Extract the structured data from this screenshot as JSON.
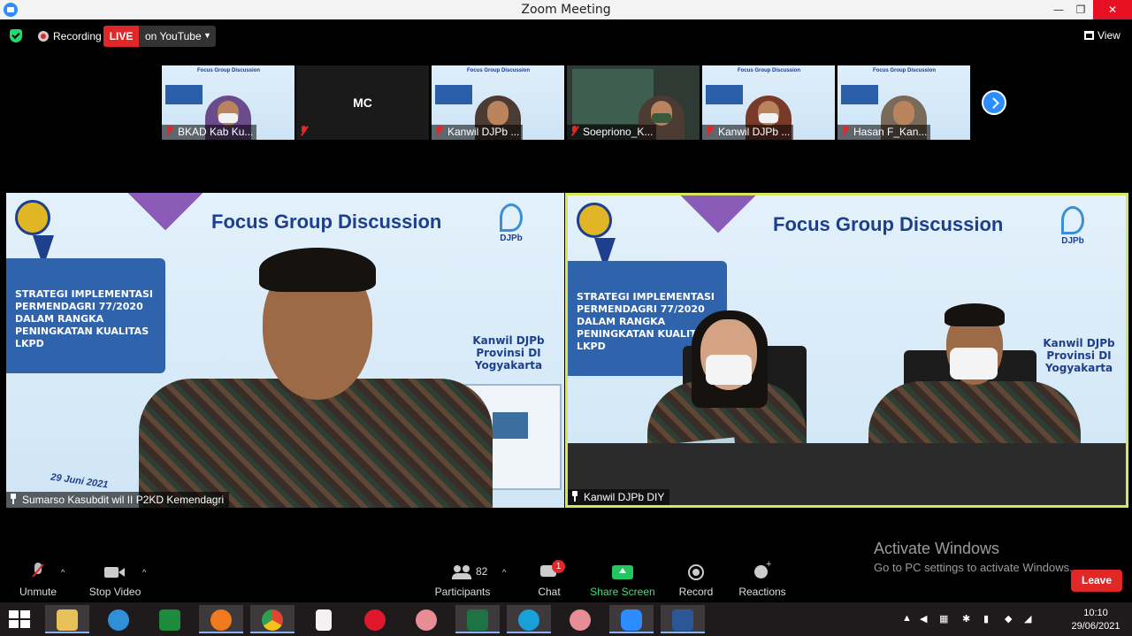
{
  "window": {
    "title": "Zoom Meeting",
    "min": "—",
    "max": "❐",
    "close": "✕"
  },
  "status": {
    "recording_label": "Recording",
    "live_badge": "LIVE",
    "live_target": "on YouTube",
    "caret": "▼",
    "view_label": "View"
  },
  "thumbnails": [
    {
      "name": "BKAD Kab Ku...",
      "type": "slide-person",
      "muted": true
    },
    {
      "name": "MC",
      "type": "name-only",
      "muted": true
    },
    {
      "name": "Kanwil DJPb ...",
      "type": "slide-person",
      "muted": true
    },
    {
      "name": "Soepriono_K...",
      "type": "room",
      "muted": true
    },
    {
      "name": "Kanwil DJPb ...",
      "type": "slide-person",
      "muted": true
    },
    {
      "name": "Hasan F_Kan...",
      "type": "slide-person",
      "muted": true
    }
  ],
  "slide": {
    "title": "Focus Group Discussion",
    "box_text": "STRATEGI IMPLEMENTASI PERMENDAGRI 77/2020 DALAM RANGKA PENINGKATAN KUALITAS LKPD",
    "kanwil": "Kanwil DJPb Provinsi DI Yogyakarta",
    "djpb": "DJPb",
    "date": "29 Juni 2021"
  },
  "left_pane": {
    "name": "Sumarso Kasubdit wil II P2KD Kemendagri"
  },
  "right_pane": {
    "name": "Kanwil DJPb DIY",
    "active_speaker": true,
    "accent": "#d6e85a"
  },
  "watermark": {
    "line1": "Activate Windows",
    "line2": "Go to PC settings to activate Windows."
  },
  "toolbar": {
    "unmute": "Unmute",
    "stop_video": "Stop Video",
    "participants": "Participants",
    "participants_count": "82",
    "chat": "Chat",
    "chat_badge": "1",
    "share_screen": "Share Screen",
    "record": "Record",
    "reactions": "Reactions",
    "leave": "Leave",
    "caret": "^"
  },
  "taskbar": {
    "apps": [
      "file-explorer",
      "internet-explorer",
      "spreadsheet-app",
      "firefox",
      "chrome",
      "document",
      "opera",
      "app",
      "excel",
      "edge",
      "app",
      "zoom",
      "word"
    ],
    "time": "10:10",
    "date": "29/06/2021"
  },
  "colors": {
    "live": "#e02828",
    "share": "#23c55e",
    "accent_blue": "#2d8cff",
    "leave": "#e02828"
  }
}
